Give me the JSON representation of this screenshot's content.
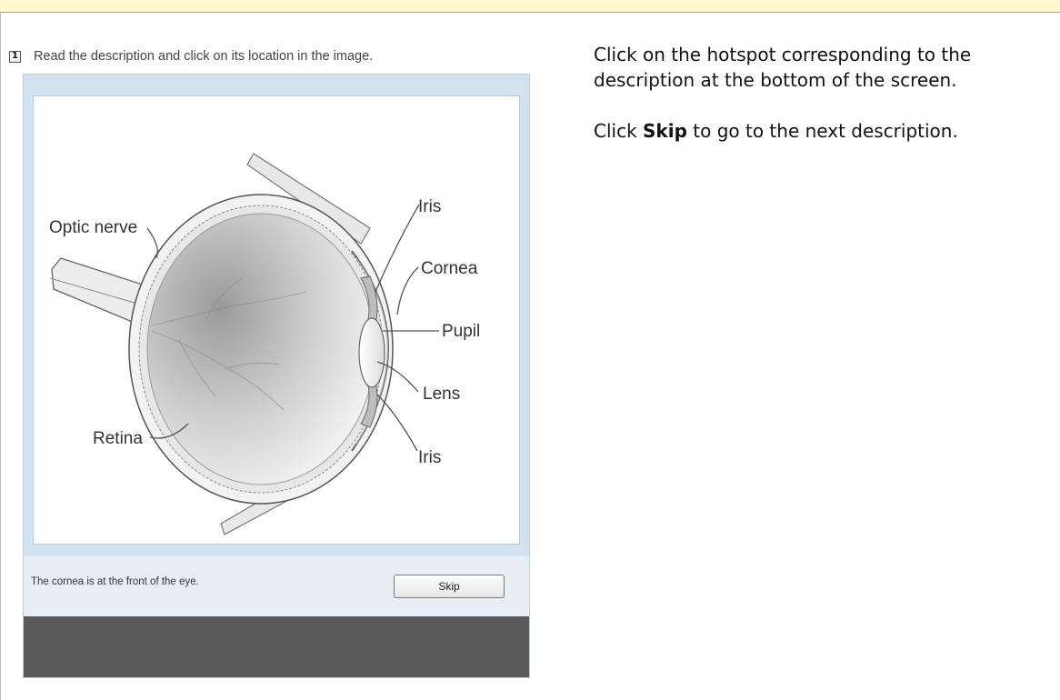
{
  "instruction": {
    "text": "Read the description and click on its location in the image."
  },
  "diagram": {
    "labels": {
      "optic_nerve": "Optic nerve",
      "iris_top": "Iris",
      "cornea": "Cornea",
      "pupil": "Pupil",
      "lens": "Lens",
      "retina": "Retina",
      "iris_bottom": "Iris"
    }
  },
  "question": {
    "description": "The cornea is at the front of the eye.",
    "skip_label": "Skip"
  },
  "help": {
    "line1": "Click on the hotspot corresponding to the description at the bottom of the screen.",
    "line2_prefix": "Click ",
    "line2_bold": "Skip",
    "line2_suffix": " to go to the next description."
  },
  "colors": {
    "top_bar": "#fdf8cf",
    "widget_bg": "#d2e2f1",
    "footer_light": "#e9eef5",
    "footer_dark": "#595959"
  }
}
